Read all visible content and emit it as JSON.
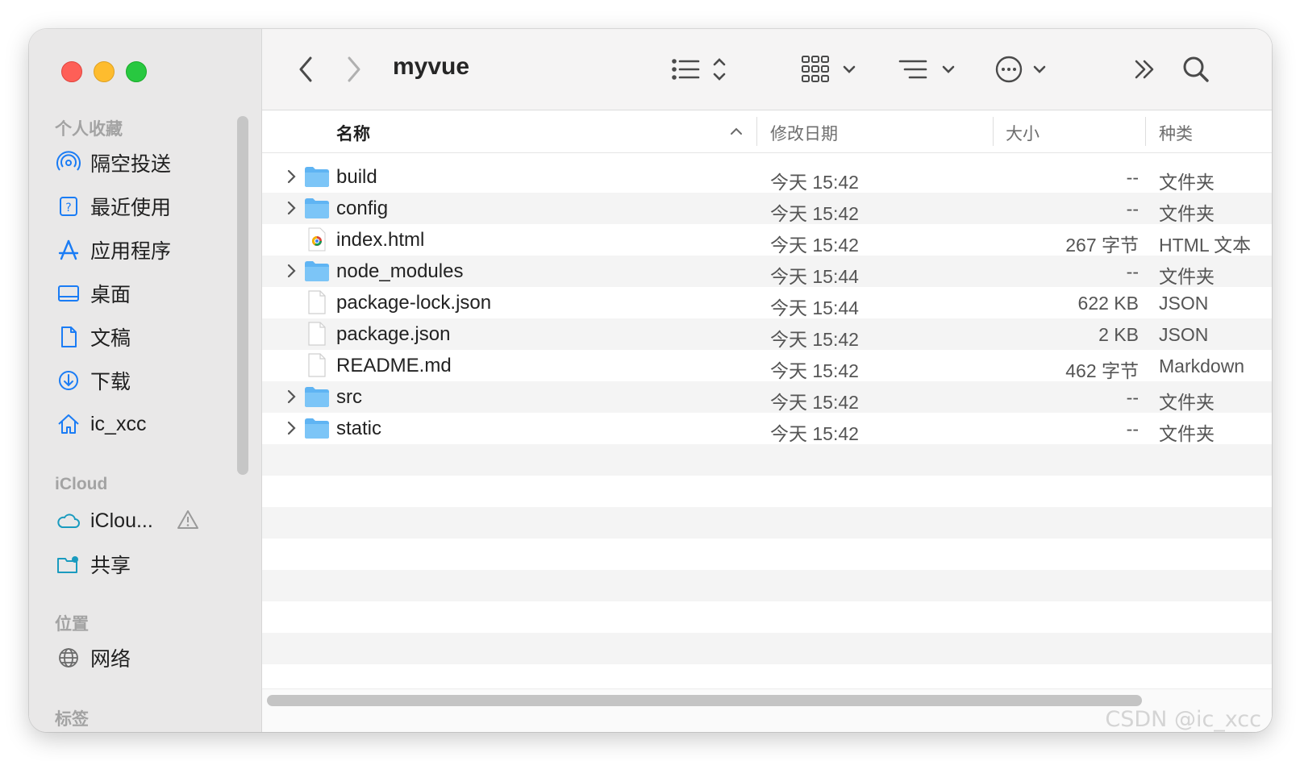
{
  "window": {
    "title": "myvue"
  },
  "sidebar": {
    "favorites_header": "个人收藏",
    "favorites": [
      {
        "label": "隔空投送",
        "icon": "airdrop-icon"
      },
      {
        "label": "最近使用",
        "icon": "recents-icon"
      },
      {
        "label": "应用程序",
        "icon": "applications-icon"
      },
      {
        "label": "桌面",
        "icon": "desktop-icon"
      },
      {
        "label": "文稿",
        "icon": "documents-icon"
      },
      {
        "label": "下载",
        "icon": "downloads-icon"
      },
      {
        "label": "ic_xcc",
        "icon": "home-icon"
      }
    ],
    "icloud_header": "iCloud",
    "icloud": [
      {
        "label": "iClou...",
        "icon": "icloud-icon",
        "warning": true
      },
      {
        "label": "共享",
        "icon": "shared-folder-icon"
      }
    ],
    "locations_header": "位置",
    "locations": [
      {
        "label": "网络",
        "icon": "network-icon"
      }
    ],
    "tags_header": "标签"
  },
  "toolbar": {
    "back": "chevron-left-icon",
    "forward": "chevron-right-icon",
    "list_view": "list-view-icon",
    "group": "grid-group-icon",
    "sort": "sort-lines-icon",
    "more": "ellipsis-circle-icon",
    "overflow": "double-chevron-icon",
    "search": "search-icon"
  },
  "columns": {
    "name": "名称",
    "date": "修改日期",
    "size": "大小",
    "kind": "种类"
  },
  "files": [
    {
      "name": "build",
      "date": "今天 15:42",
      "size": "--",
      "kind": "文件夹",
      "type": "folder"
    },
    {
      "name": "config",
      "date": "今天 15:42",
      "size": "--",
      "kind": "文件夹",
      "type": "folder"
    },
    {
      "name": "index.html",
      "date": "今天 15:42",
      "size": "267 字节",
      "kind": "HTML 文本",
      "type": "html"
    },
    {
      "name": "node_modules",
      "date": "今天 15:44",
      "size": "--",
      "kind": "文件夹",
      "type": "folder"
    },
    {
      "name": "package-lock.json",
      "date": "今天 15:44",
      "size": "622 KB",
      "kind": "JSON",
      "type": "doc"
    },
    {
      "name": "package.json",
      "date": "今天 15:42",
      "size": "2 KB",
      "kind": "JSON",
      "type": "doc"
    },
    {
      "name": "README.md",
      "date": "今天 15:42",
      "size": "462 字节",
      "kind": "Markdown",
      "type": "doc"
    },
    {
      "name": "src",
      "date": "今天 15:42",
      "size": "--",
      "kind": "文件夹",
      "type": "folder"
    },
    {
      "name": "static",
      "date": "今天 15:42",
      "size": "--",
      "kind": "文件夹",
      "type": "folder"
    }
  ],
  "watermark": "CSDN @ic_xcc",
  "colors": {
    "accent": "#1a7cf5",
    "folder": "#5fb4f3",
    "close": "#fe5f57",
    "minimize": "#febc2e",
    "zoom": "#28c840"
  }
}
